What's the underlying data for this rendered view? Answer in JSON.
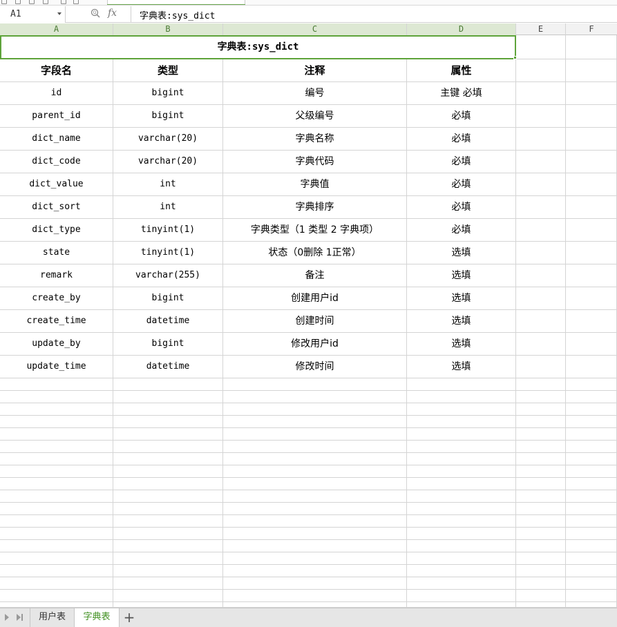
{
  "formula_bar": {
    "cell_ref": "A1",
    "formula": "字典表:sys_dict",
    "fx_label": "fx"
  },
  "columns": [
    "A",
    "B",
    "C",
    "D",
    "E",
    "F"
  ],
  "sheet": {
    "title": "字典表:sys_dict",
    "headers": [
      "字段名",
      "类型",
      "注释",
      "属性"
    ],
    "rows": [
      [
        "id",
        "bigint",
        "编号",
        "主键 必填"
      ],
      [
        "parent_id",
        "bigint",
        "父级编号",
        "必填"
      ],
      [
        "dict_name",
        "varchar(20)",
        "字典名称",
        "必填"
      ],
      [
        "dict_code",
        "varchar(20)",
        "字典代码",
        "必填"
      ],
      [
        "dict_value",
        "int",
        "字典值",
        "必填"
      ],
      [
        "dict_sort",
        "int",
        "字典排序",
        "必填"
      ],
      [
        "dict_type",
        "tinyint(1)",
        "字典类型（1 类型 2 字典项）",
        "必填"
      ],
      [
        "state",
        "tinyint(1)",
        "状态（0删除 1正常）",
        "选填"
      ],
      [
        "remark",
        "varchar(255)",
        "备注",
        "选填"
      ],
      [
        "create_by",
        "bigint",
        "创建用户id",
        "选填"
      ],
      [
        "create_time",
        "datetime",
        "创建时间",
        "选填"
      ],
      [
        "update_by",
        "bigint",
        "修改用户id",
        "选填"
      ],
      [
        "update_time",
        "datetime",
        "修改时间",
        "选填"
      ]
    ]
  },
  "sheet_tabs": [
    {
      "label": "用户表",
      "active": false
    },
    {
      "label": "字典表",
      "active": true
    }
  ],
  "colors": {
    "selection": "#5ea33a",
    "active_tab_text": "#3e8f1e"
  }
}
